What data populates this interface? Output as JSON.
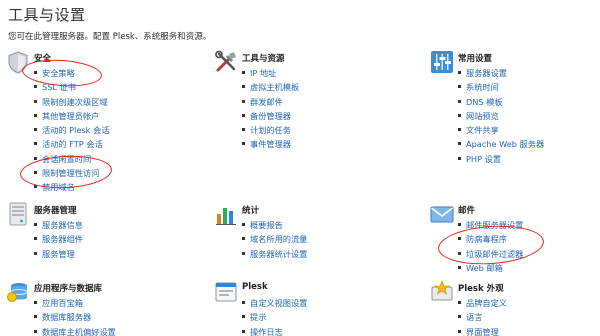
{
  "page": {
    "title": "工具与设置",
    "subtitle": "您可在此管理服务器。配置 Plesk、系统服务和资源。"
  },
  "sections": {
    "security": {
      "title": "安全",
      "icon": "shield-icon",
      "items": [
        "安全策略",
        "SSL 证书",
        "限制创建次级区域",
        "其他管理员帐户",
        "活动的 Plesk 会话",
        "活动的 FTP 会话",
        "会话闲置时间",
        "限制管理性访问",
        "禁用域名"
      ]
    },
    "tools": {
      "title": "工具与资源",
      "icon": "tools-icon",
      "items": [
        "IP 地址",
        "虚拟主机模板",
        "群发邮件",
        "备份管理器",
        "计划的任务",
        "事件管理器"
      ]
    },
    "general": {
      "title": "常用设置",
      "icon": "sliders-icon",
      "items": [
        "服务器设置",
        "系统时间",
        "DNS 模板",
        "网站预览",
        "文件共享",
        "Apache Web 服务器",
        "PHP 设置"
      ]
    },
    "server": {
      "title": "服务器管理",
      "icon": "server-icon",
      "items": [
        "服务器信息",
        "服务器组件",
        "服务管理"
      ]
    },
    "stats": {
      "title": "统计",
      "icon": "bar-chart-icon",
      "items": [
        "概要报告",
        "域名所用的流量",
        "服务器统计设置"
      ]
    },
    "mail": {
      "title": "邮件",
      "icon": "envelope-icon",
      "items": [
        "邮件服务器设置",
        "防病毒程序",
        "垃圾邮件过滤器",
        "Web 邮箱"
      ]
    },
    "apps": {
      "title": "应用程序与数据库",
      "icon": "database-icon",
      "items": [
        "应用百宝箱",
        "数据库服务器",
        "数据库主机偏好设置"
      ]
    },
    "plesk": {
      "title": "Plesk",
      "icon": "plesk-window-icon",
      "items": [
        "自定义视图设置",
        "提示",
        "操作日志"
      ]
    },
    "appearance": {
      "title": "Plesk 外观",
      "icon": "star-monitor-icon",
      "items": [
        "品牌自定义",
        "语言",
        "界面管理"
      ]
    }
  },
  "colors": {
    "link": "#2266bb",
    "annotation": "#e2231a"
  }
}
